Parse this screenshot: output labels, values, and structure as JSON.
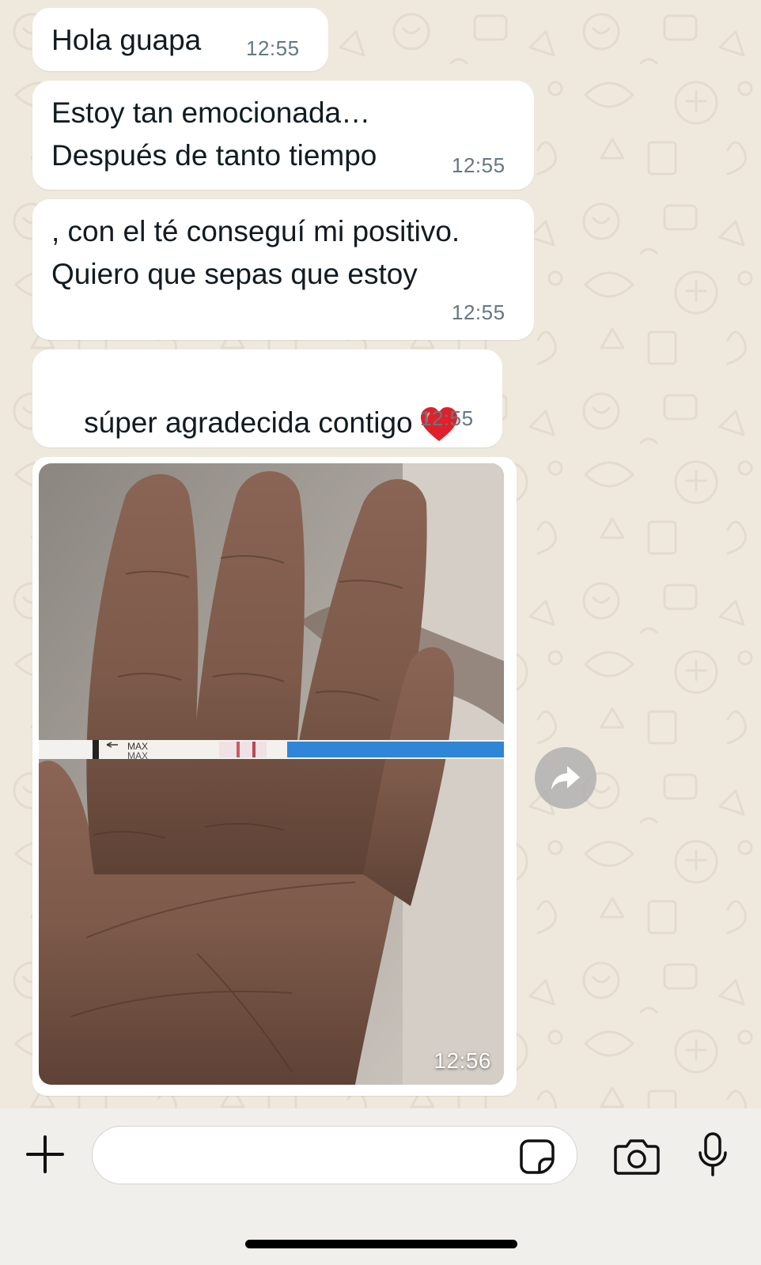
{
  "messages": [
    {
      "text": "Hola guapa",
      "time": "12:55"
    },
    {
      "lines": [
        "Estoy tan emocionada…",
        "Después de tanto tiempo"
      ],
      "time": "12:55"
    },
    {
      "lines": [
        ", con el té conseguí mi positivo.",
        "Quiero que sepas que estoy"
      ],
      "time": "12:55"
    },
    {
      "text": "súper agradecida contigo",
      "emoji": "heart-emoji",
      "time": "12:55"
    },
    {
      "media": "photo",
      "time": "12:56"
    }
  ],
  "photo": {
    "strip_label_1": "MAX",
    "strip_label_2": "MAX"
  },
  "composer": {
    "placeholder": "",
    "value": ""
  },
  "icons": {
    "plus": "plus-icon",
    "sticker": "sticker-icon",
    "camera": "camera-icon",
    "mic": "microphone-icon",
    "forward": "forward-icon"
  },
  "colors": {
    "chat_background": "#efe8dd",
    "bubble": "#ffffff",
    "timestamp": "#667781",
    "test_strip_blue": "#2f86d6"
  }
}
